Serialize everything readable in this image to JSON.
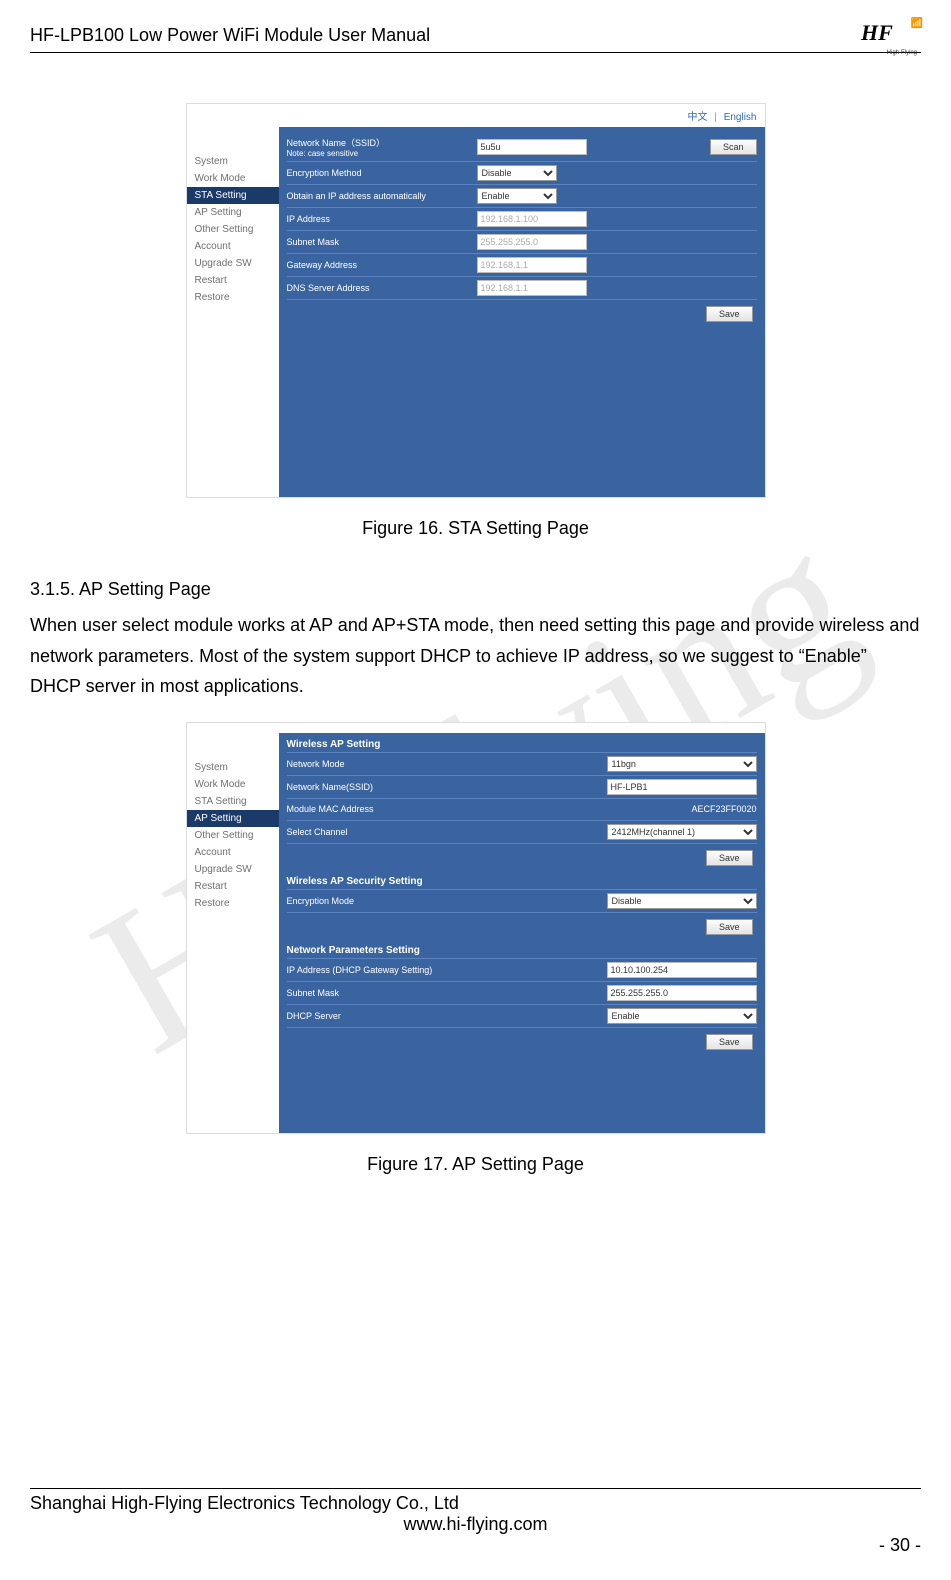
{
  "header": {
    "title": "HF-LPB100 Low Power WiFi Module User Manual",
    "logo_text": "HF",
    "logo_sub": "High-Flying"
  },
  "watermark": "Hi-Flying",
  "lang": {
    "zh": "中文",
    "en": "English",
    "sep": "|"
  },
  "nav": {
    "items": [
      "System",
      "Work Mode",
      "STA Setting",
      "AP Setting",
      "Other Setting",
      "Account",
      "Upgrade SW",
      "Restart",
      "Restore"
    ]
  },
  "fig16": {
    "active_nav": "STA Setting",
    "rows": {
      "ssid_label": "Network Name（SSID）",
      "ssid_note": "Note: case sensitive",
      "ssid_value": "5u5u",
      "scan_btn": "Scan",
      "enc_label": "Encryption Method",
      "enc_value": "Disable",
      "dhcp_label": "Obtain an IP address automatically",
      "dhcp_value": "Enable",
      "ip_label": "IP Address",
      "ip_value": "192.168.1.100",
      "mask_label": "Subnet Mask",
      "mask_value": "255.255.255.0",
      "gw_label": "Gateway Address",
      "gw_value": "192.168.1.1",
      "dns_label": "DNS Server Address",
      "dns_value": "192.168.1.1"
    },
    "save_btn": "Save",
    "caption": "Figure 16.    STA Setting Page"
  },
  "section315": {
    "heading": "3.1.5.    AP Setting Page",
    "body": "When user select module works at AP and AP+STA mode, then need setting this page and provide wireless and network parameters. Most of the system support DHCP to achieve IP address, so we suggest to “Enable” DHCP server in most applications."
  },
  "fig17": {
    "active_nav": "AP Setting",
    "sec1_title": "Wireless AP Setting",
    "netmode_label": "Network Mode",
    "netmode_value": "11bgn",
    "ssid_label": "Network Name(SSID)",
    "ssid_value": "HF-LPB1",
    "mac_label": "Module MAC Address",
    "mac_value": "AECF23FF0020",
    "chan_label": "Select Channel",
    "chan_value": "2412MHz(channel 1)",
    "sec2_title": "Wireless AP Security Setting",
    "encmode_label": "Encryption Mode",
    "encmode_value": "Disable",
    "sec3_title": "Network Parameters Setting",
    "ipgw_label": "IP Address (DHCP Gateway Setting)",
    "ipgw_value": "10.10.100.254",
    "mask_label": "Subnet Mask",
    "mask_value": "255.255.255.0",
    "dhcpserv_label": "DHCP Server",
    "dhcpserv_value": "Enable",
    "save_btn": "Save",
    "caption": "Figure 17.    AP Setting Page"
  },
  "footer": {
    "company": "Shanghai High-Flying Electronics Technology Co., Ltd",
    "site": "www.hi-flying.com",
    "page": "- 30 -"
  }
}
